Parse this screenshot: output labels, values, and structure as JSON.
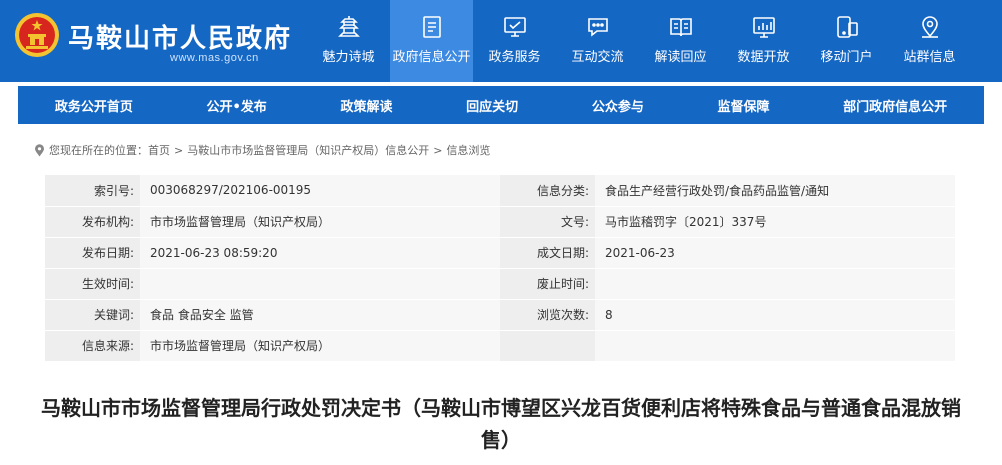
{
  "header": {
    "site_title": "马鞍山市人民政府",
    "site_url": "www.mas.gov.cn",
    "nav": [
      {
        "label": "魅力诗城",
        "icon": "pagoda-icon"
      },
      {
        "label": "政府信息公开",
        "icon": "document-icon",
        "active": true
      },
      {
        "label": "政务服务",
        "icon": "monitor-icon"
      },
      {
        "label": "互动交流",
        "icon": "chat-icon"
      },
      {
        "label": "解读回应",
        "icon": "book-icon"
      },
      {
        "label": "数据开放",
        "icon": "data-icon"
      },
      {
        "label": "移动门户",
        "icon": "mobile-icon"
      },
      {
        "label": "站群信息",
        "icon": "location-icon"
      }
    ]
  },
  "sub_nav": [
    "政务公开首页",
    "公开•发布",
    "政策解读",
    "回应关切",
    "公众参与",
    "监督保障",
    "部门政府信息公开"
  ],
  "breadcrumb": {
    "prefix": "您现在所在的位置：",
    "items": [
      "首页",
      "马鞍山市市场监督管理局（知识产权局）信息公开",
      "信息浏览"
    ],
    "sep": ">"
  },
  "info_rows": [
    {
      "k1": "索引号:",
      "v1": "003068297/202106-00195",
      "k2": "信息分类:",
      "v2": "食品生产经营行政处罚/食品药品监管/通知"
    },
    {
      "k1": "发布机构:",
      "v1": "市市场监督管理局（知识产权局）",
      "k2": "文号:",
      "v2": "马市监稽罚字〔2021〕337号"
    },
    {
      "k1": "发布日期:",
      "v1": "2021-06-23 08:59:20",
      "k2": "成文日期:",
      "v2": "2021-06-23"
    },
    {
      "k1": "生效时间:",
      "v1": "",
      "k2": "废止时间:",
      "v2": ""
    },
    {
      "k1": "关键词:",
      "v1": "食品  食品安全  监管",
      "k2": "浏览次数:",
      "v2": "8"
    },
    {
      "k1": "信息来源:",
      "v1": "市市场监督管理局（知识产权局）",
      "k2": "",
      "v2": ""
    }
  ],
  "doc_title": "马鞍山市市场监督管理局行政处罚决定书（马鞍山市博望区兴龙百货便利店将特殊食品与普通食品混放销售）",
  "colors": {
    "brand_blue": "#1567c4",
    "active_blue": "#3d8ae3",
    "emblem_red": "#d7261e",
    "emblem_gold": "#f4c430"
  }
}
